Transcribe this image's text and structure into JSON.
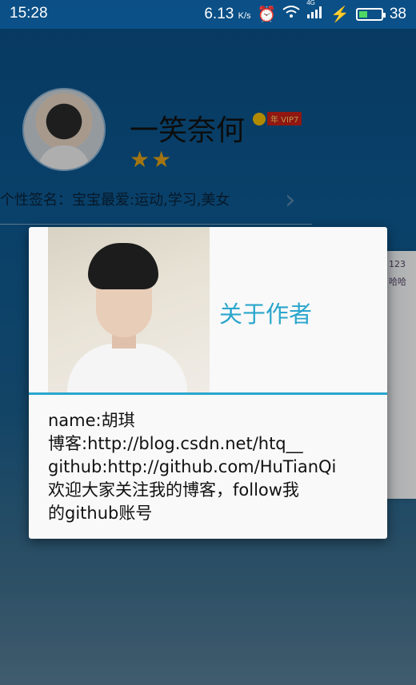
{
  "status_bar": {
    "time": "15:28",
    "speed": "6.13",
    "speed_unit": "K/s",
    "network": "4G",
    "battery": "38",
    "battery_level": 0.38
  },
  "profile": {
    "username": "一笑奈何",
    "vip_tag": "年 VIP7",
    "stars": [
      "★",
      "★"
    ],
    "signature": "个性签名：宝宝最爱:运动,学习,美女"
  },
  "side_card": {
    "text_top": "123",
    "text_sub": "哈哈"
  },
  "dialog": {
    "title": "关于作者",
    "lines": [
      "name:胡琪",
      "博客:http://blog.csdn.net/htq__",
      "github:http://github.com/HuTianQi",
      "欢迎大家关注我的博客，follow我",
      "的github账号"
    ]
  },
  "colors": {
    "accent": "#2aa6cc",
    "star": "#e1a21a",
    "background": "#0b4f86"
  }
}
